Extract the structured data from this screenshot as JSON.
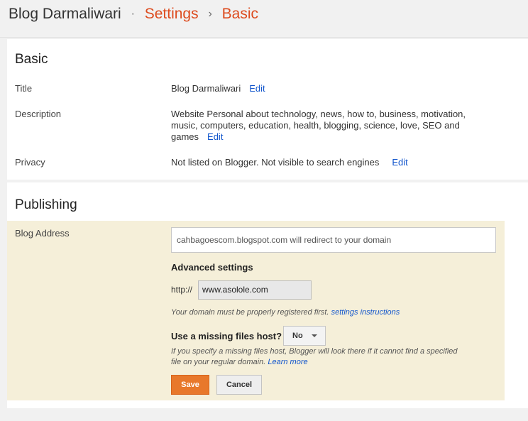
{
  "breadcrumb": {
    "blog": "Blog Darmaliwari",
    "sep1": "·",
    "settings": "Settings",
    "sep2": "›",
    "page": "Basic"
  },
  "basic": {
    "heading": "Basic",
    "title_label": "Title",
    "title_value": "Blog Darmaliwari",
    "description_label": "Description",
    "description_line1": "Website Personal about technology, news, how to, business, motivation,",
    "description_line2": "music, computers, education, health, blogging, science, love, SEO and",
    "description_line3": "games",
    "privacy_label": "Privacy",
    "privacy_value": "Not listed on Blogger. Not visible to search engines",
    "edit_label": "Edit"
  },
  "publishing": {
    "heading": "Publishing",
    "blog_address_label": "Blog Address",
    "blog_address_value": "cahbagoescom.blogspot.com    will redirect to your domain",
    "advanced_settings": "Advanced settings",
    "http_prefix": "http://",
    "domain_value": "www.asolole.com",
    "domain_hint": "Your domain must be properly registered first.",
    "settings_instructions": "settings instructions",
    "missing_host_label": "Use a missing files host?",
    "missing_host_value": "No",
    "missing_hint_line1": "If you specify a missing files host, Blogger will look there if it cannot find a specified",
    "missing_hint_line2": "file on your regular domain.",
    "learn_more": "Learn more",
    "save_label": "Save",
    "cancel_label": "Cancel"
  }
}
